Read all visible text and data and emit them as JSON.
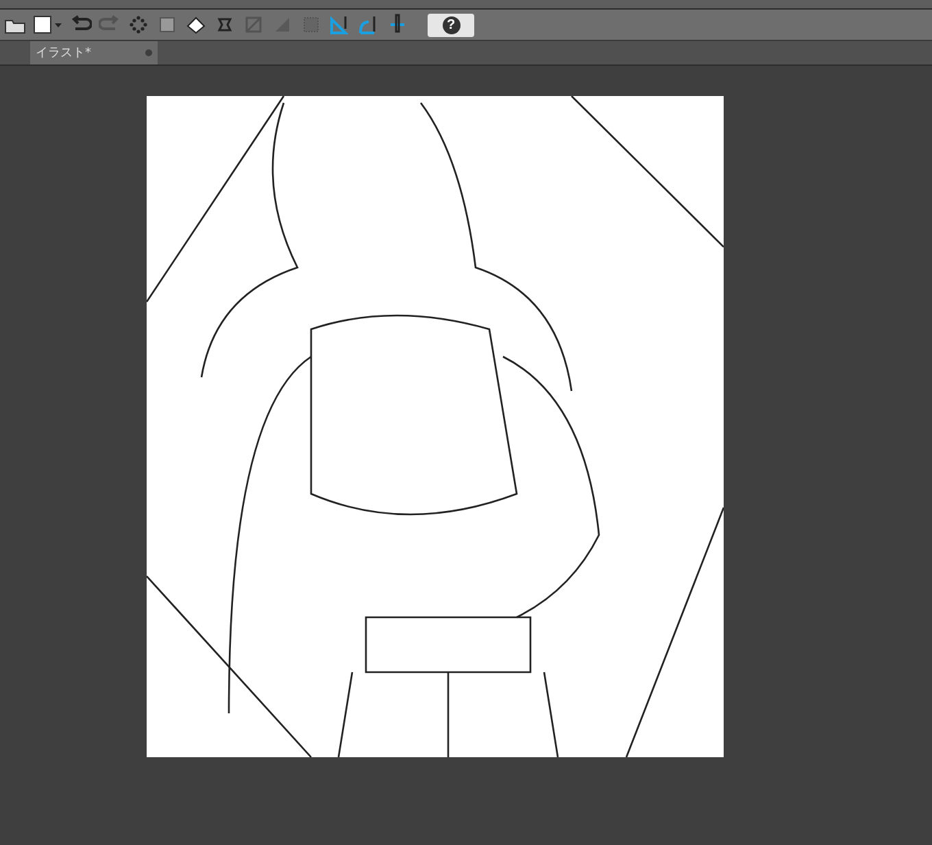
{
  "toolbar": [
    {
      "kind": "open",
      "disabled": false
    },
    {
      "kind": "new",
      "disabled": false
    },
    {
      "kind": "undo",
      "disabled": false
    },
    {
      "kind": "redo",
      "disabled": true
    },
    {
      "kind": "dots",
      "disabled": false
    },
    {
      "kind": "transform",
      "disabled": false
    },
    {
      "kind": "fill",
      "disabled": false
    },
    {
      "kind": "scale",
      "disabled": false
    },
    {
      "kind": "clear",
      "disabled": true
    },
    {
      "kind": "gradient",
      "disabled": true
    },
    {
      "kind": "grid",
      "disabled": true
    },
    {
      "kind": "ruler",
      "disabled": false
    },
    {
      "kind": "curve",
      "disabled": false
    },
    {
      "kind": "pen",
      "disabled": false
    }
  ],
  "help": {
    "label": "?"
  },
  "tabs": [
    {
      "label": "イラスト*",
      "selected": true
    }
  ]
}
